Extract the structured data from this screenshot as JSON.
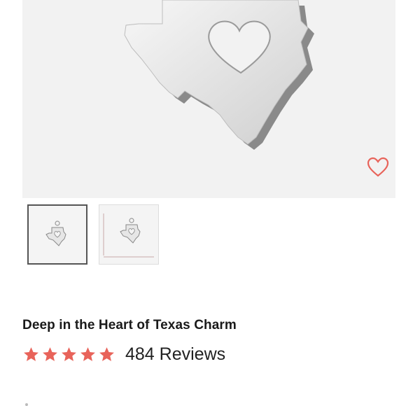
{
  "product": {
    "title": "Deep in the Heart of Texas Charm",
    "rating": 5,
    "review_count_label": "484 Reviews"
  },
  "gallery": {
    "selected_index": 0,
    "thumbnails": [
      "texas-charm-front",
      "texas-charm-size-chart"
    ]
  },
  "icons": {
    "wishlist": "heart-outline-icon",
    "rating_star": "star-icon"
  },
  "colors": {
    "accent": "#e8635a",
    "star": "#e8635a",
    "hero_background": "#f2f2f2"
  }
}
